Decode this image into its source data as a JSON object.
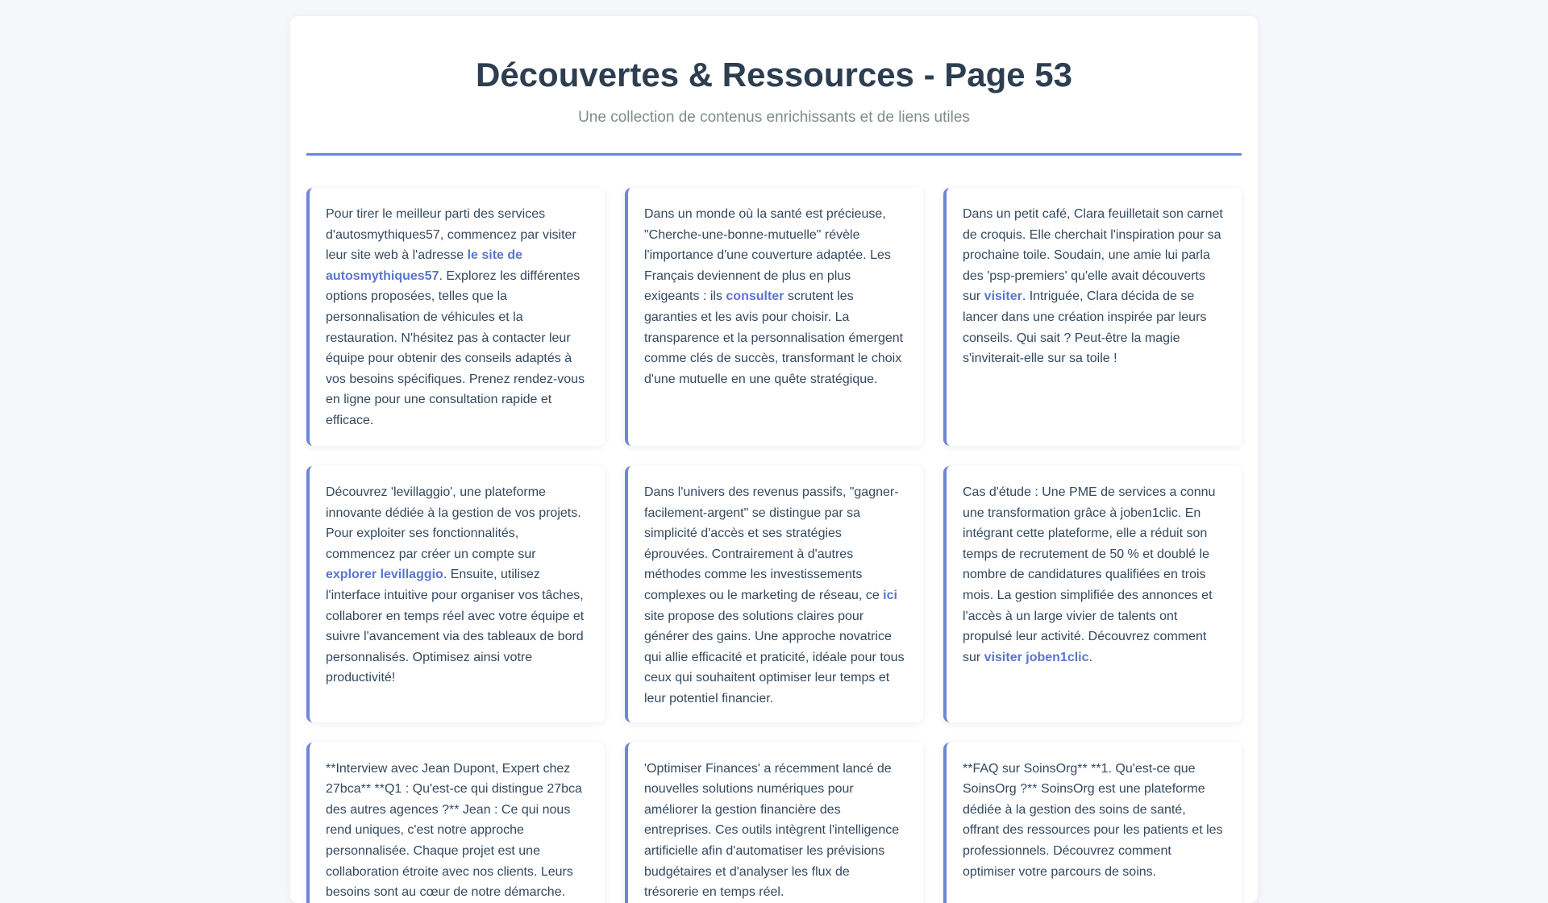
{
  "header": {
    "title": "Découvertes & Ressources - Page 53",
    "subtitle": "Une collection de contenus enrichissants et de liens utiles"
  },
  "cards": [
    {
      "before": "Pour tirer le meilleur parti des services d'autosmythiques57, commencez par visiter leur site web à l'adresse ",
      "link": "le site de autosmythiques57",
      "after": ". Explorez les différentes options proposées, telles que la personnalisation de véhicules et la restauration. N'hésitez pas à contacter leur équipe pour obtenir des conseils adaptés à vos besoins spécifiques. Prenez rendez-vous en ligne pour une consultation rapide et efficace."
    },
    {
      "before": "Dans un monde où la santé est précieuse, \"Cherche-une-bonne-mutuelle\" révèle l'importance d'une couverture adaptée. Les Français deviennent de plus en plus exigeants : ils ",
      "link": "consulter",
      "after": " scrutent les garanties et les avis pour choisir. La transparence et la personnalisation émergent comme clés de succès, transformant le choix d'une mutuelle en une quête stratégique."
    },
    {
      "before": "Dans un petit café, Clara feuilletait son carnet de croquis. Elle cherchait l'inspiration pour sa prochaine toile. Soudain, une amie lui parla des 'psp-premiers' qu'elle avait découverts sur ",
      "link": "visiter",
      "after": ". Intriguée, Clara décida de se lancer dans une création inspirée par leurs conseils. Qui sait ? Peut-être la magie s'inviterait-elle sur sa toile !"
    },
    {
      "before": "Découvrez 'levillaggio', une plateforme innovante dédiée à la gestion de vos projets. Pour exploiter ses fonctionnalités, commencez par créer un compte sur ",
      "link": "explorer levillaggio",
      "after": ". Ensuite, utilisez l'interface intuitive pour organiser vos tâches, collaborer en temps réel avec votre équipe et suivre l'avancement via des tableaux de bord personnalisés. Optimisez ainsi votre productivité!"
    },
    {
      "before": "Dans l'univers des revenus passifs, \"gagner-facilement-argent\" se distingue par sa simplicité d'accès et ses stratégies éprouvées. Contrairement à d'autres méthodes comme les investissements complexes ou le marketing de réseau, ce ",
      "link": "ici",
      "after": " site propose des solutions claires pour générer des gains. Une approche novatrice qui allie efficacité et praticité, idéale pour tous ceux qui souhaitent optimiser leur temps et leur potentiel financier."
    },
    {
      "before": "Cas d'étude : Une PME de services a connu une transformation grâce à joben1clic. En intégrant cette plateforme, elle a réduit son temps de recrutement de 50 % et doublé le nombre de candidatures qualifiées en trois mois. La gestion simplifiée des annonces et l'accès à un large vivier de talents ont propulsé leur activité. Découvrez comment sur ",
      "link": "visiter joben1clic",
      "after": "."
    },
    {
      "before": "**Interview avec Jean Dupont, Expert chez 27bca** **Q1 : Qu'est-ce qui distingue 27bca des autres agences ?** Jean : Ce qui nous rend uniques, c'est notre approche personnalisée. Chaque projet est une collaboration étroite avec nos clients. Leurs besoins sont au cœur de notre démarche.",
      "link": "",
      "after": ""
    },
    {
      "before": "'Optimiser Finances' a récemment lancé de nouvelles solutions numériques pour améliorer la gestion financière des entreprises. Ces outils intègrent l'intelligence artificielle afin d'automatiser les prévisions budgétaires et d'analyser les flux de trésorerie en temps réel.",
      "link": "",
      "after": ""
    },
    {
      "before": "**FAQ sur SoinsOrg** **1. Qu'est-ce que SoinsOrg ?** SoinsOrg est une plateforme dédiée à la gestion des soins de santé, offrant des ressources pour les patients et les professionnels. Découvrez comment optimiser votre parcours de soins.",
      "link": "",
      "after": ""
    }
  ]
}
